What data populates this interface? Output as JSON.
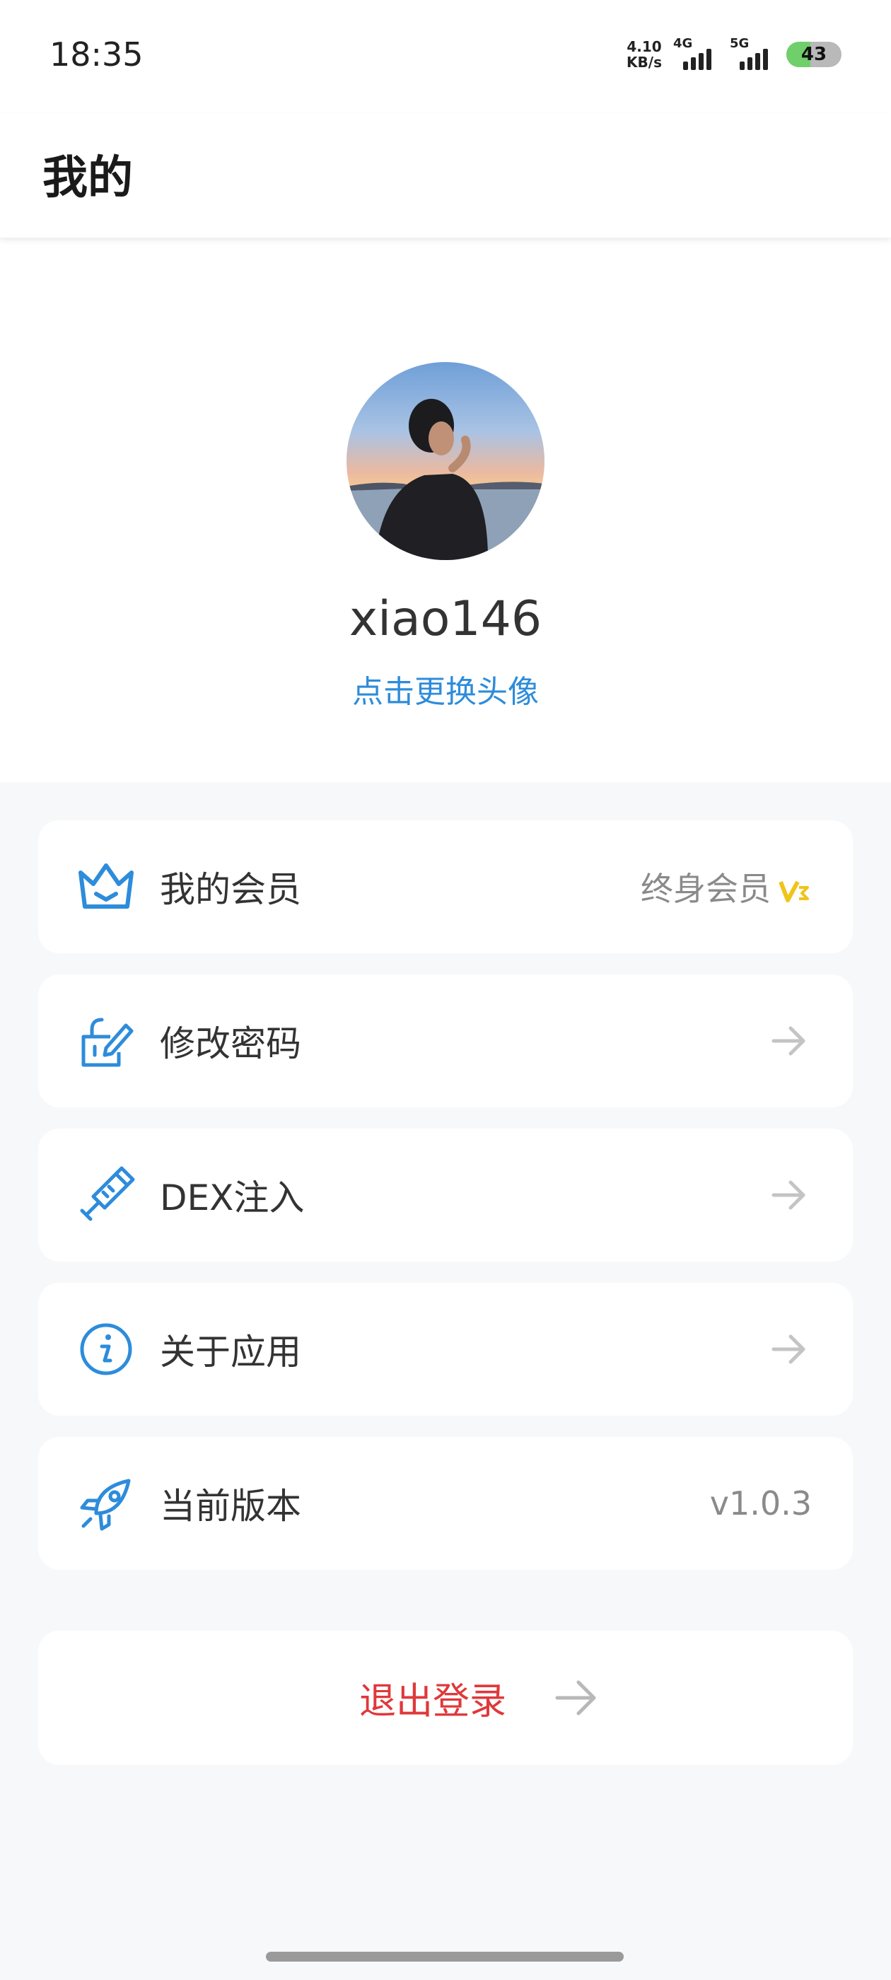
{
  "status_bar": {
    "time": "18:35",
    "net_speed_value": "4.10",
    "net_speed_unit": "KB/s",
    "sim1_label": "4G",
    "sim2_label": "5G",
    "battery_level": "43"
  },
  "header": {
    "title": "我的"
  },
  "profile": {
    "username": "xiao146",
    "change_avatar_label": "点击更换头像"
  },
  "menu": {
    "membership": {
      "label": "我的会员",
      "value": "终身会员",
      "icon": "crown-icon"
    },
    "change_password": {
      "label": "修改密码",
      "icon": "edit-lock-icon"
    },
    "dex_inject": {
      "label": "DEX注入",
      "icon": "syringe-icon"
    },
    "about": {
      "label": "关于应用",
      "icon": "info-icon"
    },
    "version": {
      "label": "当前版本",
      "value": "v1.0.3",
      "icon": "rocket-icon"
    }
  },
  "logout": {
    "label": "退出登录"
  },
  "colors": {
    "accent": "#2d8cdb",
    "danger": "#e0383b",
    "background": "#f7f8fa",
    "vip_badge": "#f0c419"
  }
}
